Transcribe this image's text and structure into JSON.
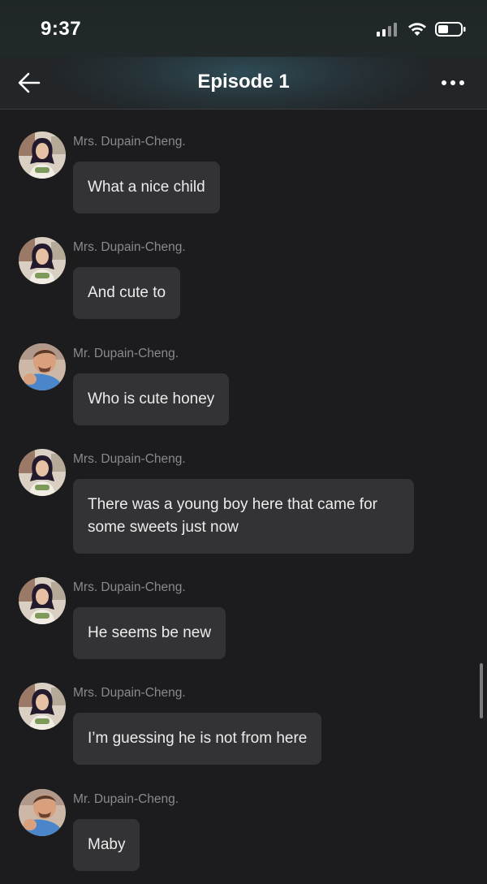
{
  "status_bar": {
    "time": "9:37"
  },
  "header": {
    "title": "Episode 1",
    "back_icon": "arrow-left-icon",
    "more_icon": "more-horizontal-icon"
  },
  "messages": [
    {
      "sender": "Mrs. Dupain-Cheng.",
      "text": "What a nice child",
      "avatar": "mrs"
    },
    {
      "sender": "Mrs. Dupain-Cheng.",
      "text": "And cute to",
      "avatar": "mrs"
    },
    {
      "sender": "Mr. Dupain-Cheng.",
      "text": "Who is cute honey",
      "avatar": "mr"
    },
    {
      "sender": "Mrs. Dupain-Cheng.",
      "text": "There was a young boy here that came for some sweets just now",
      "avatar": "mrs"
    },
    {
      "sender": "Mrs. Dupain-Cheng.",
      "text": "He seems be new",
      "avatar": "mrs"
    },
    {
      "sender": "Mrs. Dupain-Cheng.",
      "text": "I’m guessing he is not from here",
      "avatar": "mrs"
    },
    {
      "sender": "Mr. Dupain-Cheng.",
      "text": "Maby",
      "avatar": "mr"
    }
  ]
}
